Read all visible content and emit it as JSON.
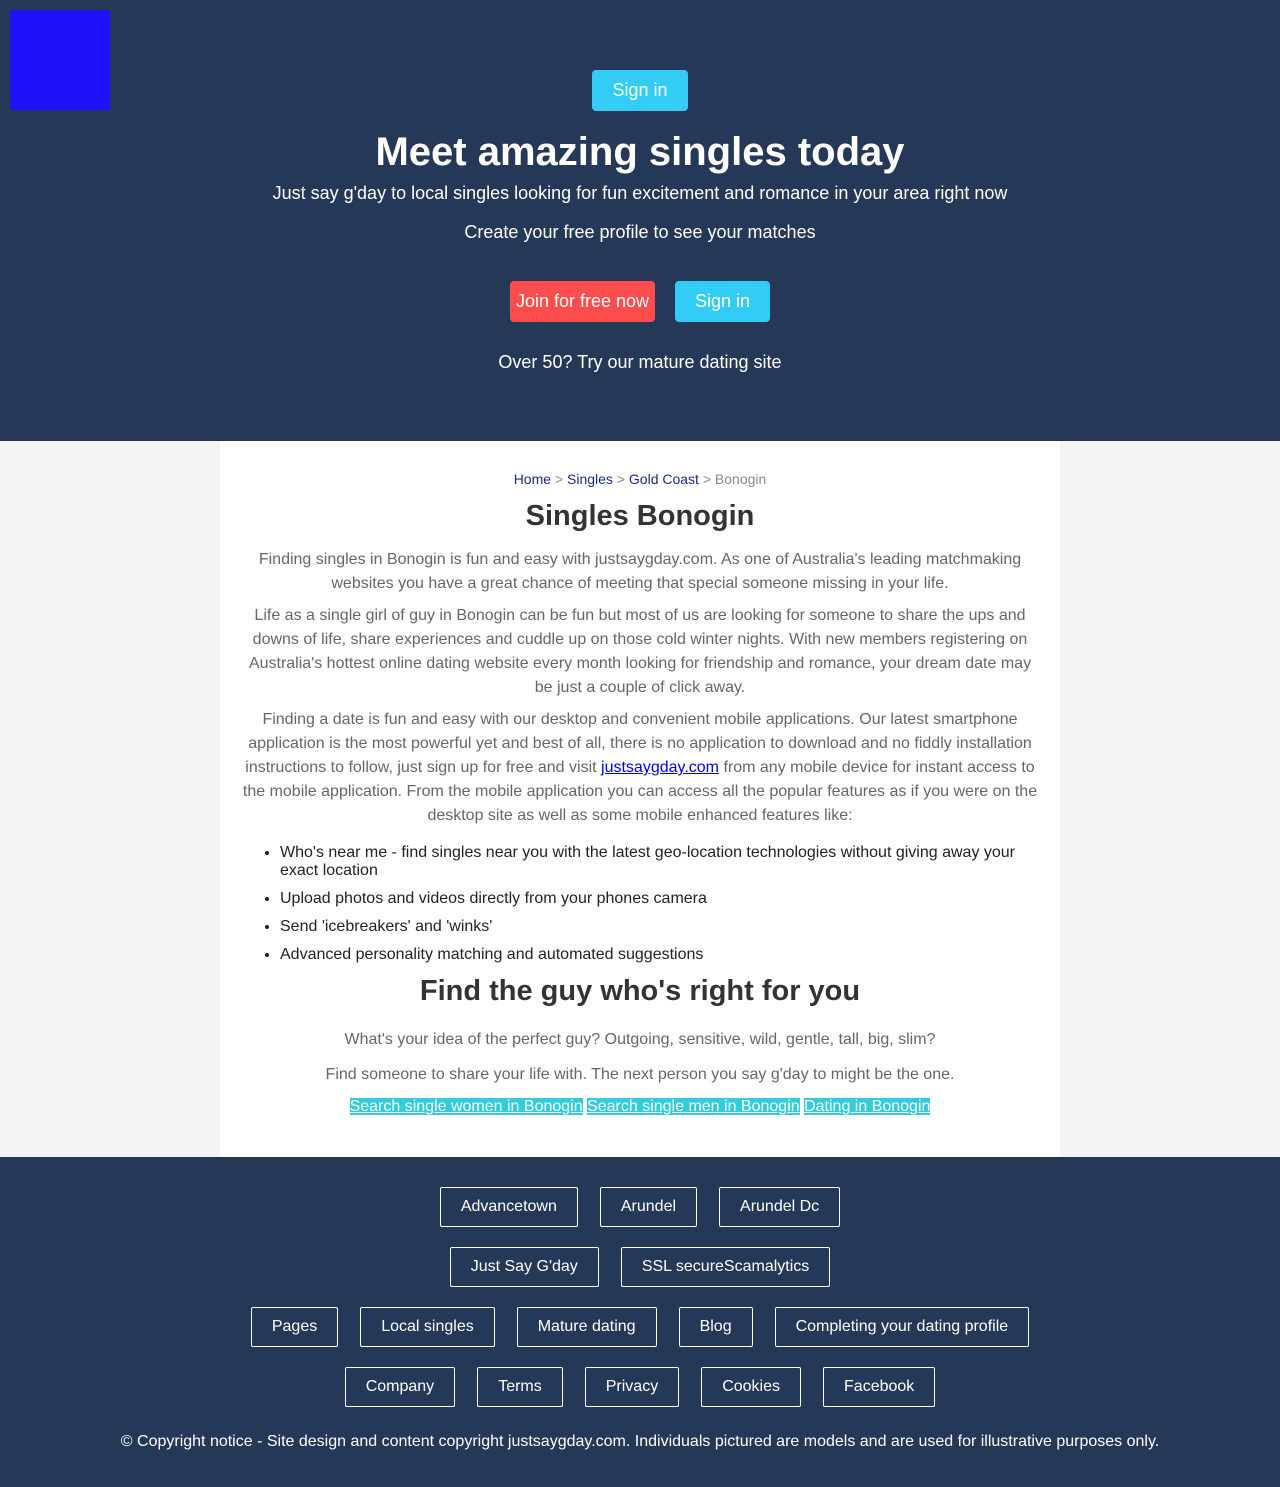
{
  "colors": {
    "hero_bg": "#253858",
    "accent_cyan": "#33ccf5",
    "accent_red": "#ff4d4d",
    "logo_blue": "#1f12fb"
  },
  "hero": {
    "signin_top": "Sign in",
    "title": "Meet amazing singles today",
    "tagline": "Just say g'day to local singles looking for fun excitement and romance in your area right now",
    "create": "Create your free profile to see your matches",
    "join_button": "Join for free now",
    "signin_button": "Sign in",
    "mature_link": "Over 50? Try our mature dating site"
  },
  "breadcrumb": {
    "home": "Home",
    "sep": " > ",
    "singles": "Singles",
    "region": "Gold Coast",
    "current": "Bonogin"
  },
  "main": {
    "title": "Singles Bonogin",
    "p1": "Finding singles in Bonogin is fun and easy with justsaygday.com. As one of Australia's leading matchmaking websites you have a great chance of meeting that special someone missing in your life.",
    "p2": "Life as a single girl of guy in Bonogin can be fun but most of us are looking for someone to share the ups and downs of life, share experiences and cuddle up on those cold winter nights. With new members registering on Australia's hottest online dating website every month looking for friendship and romance, your dream date may be just a couple of click away.",
    "p3_before": "Finding a date is fun and easy with our desktop and convenient mobile applications. Our latest smartphone application is the most powerful yet and best of all, there is no application to download and no fiddly installation instructions to follow, just sign up for free and visit ",
    "p3_link": "justsaygday.com",
    "p3_after": " from any mobile device for instant access to the mobile application. From the mobile application you can access all the popular features as if you were on the desktop site as well as some mobile enhanced features like:",
    "features": [
      "Who's near me - find singles near you with the latest geo-location technologies without giving away your exact location",
      "Upload photos and videos directly from your phones camera",
      "Send 'icebreakers' and 'winks'",
      "Advanced personality matching and automated suggestions"
    ],
    "subtitle": "Find the guy who's right for you",
    "q1": "What's your idea of the perfect guy? Outgoing, sensitive, wild, gentle, tall, big, slim?",
    "q2": "Find someone to share your life with. The next person you say g'day to might be the one.",
    "search_links": [
      "Search single women in Bonogin",
      "Search single men in Bonogin",
      "Dating in Bonogin"
    ]
  },
  "footer": {
    "row1": [
      "Advancetown",
      "Arundel",
      "Arundel Dc"
    ],
    "row2": [
      "Just Say G'day",
      "SSL secureScamalytics"
    ],
    "row3": [
      "Pages",
      "Local singles",
      "Mature dating",
      "Blog",
      "Completing your dating profile"
    ],
    "row4": [
      "Company",
      "Terms",
      "Privacy",
      "Cookies",
      "Facebook"
    ],
    "copyright": "© Copyright notice - Site design and content copyright justsaygday.com. Individuals pictured are models and are used for illustrative purposes only."
  }
}
